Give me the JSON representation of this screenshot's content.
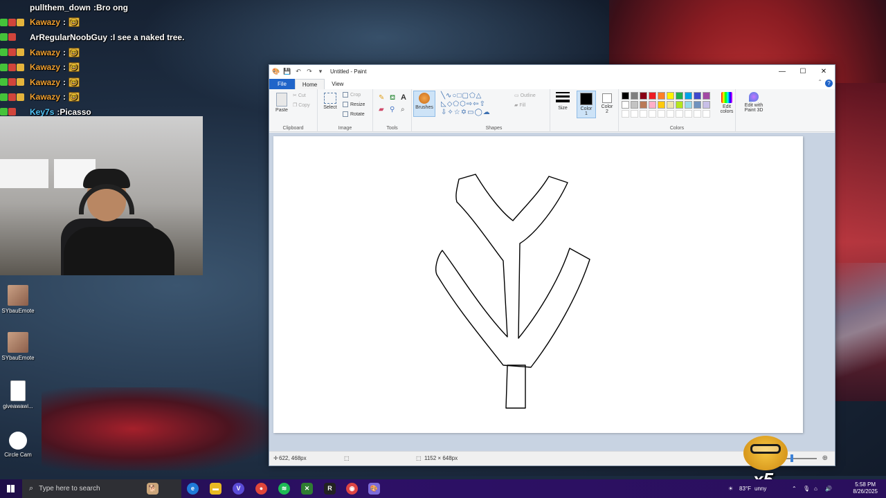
{
  "chat": {
    "messages": [
      {
        "user": "pullthem_down",
        "text": "Bro ong",
        "user_color": "#ffffff",
        "badges": [],
        "emote": false
      },
      {
        "user": "Kawazy",
        "text": "",
        "user_color": "#f0a030",
        "badges": [
          "green",
          "red",
          "gold"
        ],
        "emote": true
      },
      {
        "user": "ArRegularNoobGuy",
        "text": "I see a naked tree.",
        "user_color": "#ffffff",
        "badges": [
          "green",
          "red"
        ],
        "emote": false
      },
      {
        "user": "Kawazy",
        "text": "",
        "user_color": "#f0a030",
        "badges": [
          "green",
          "red",
          "gold"
        ],
        "emote": true
      },
      {
        "user": "Kawazy",
        "text": "",
        "user_color": "#f0a030",
        "badges": [
          "green",
          "red",
          "gold"
        ],
        "emote": true
      },
      {
        "user": "Kawazy",
        "text": "",
        "user_color": "#f0a030",
        "badges": [
          "green",
          "red",
          "gold"
        ],
        "emote": true
      },
      {
        "user": "Kawazy",
        "text": "",
        "user_color": "#f0a030",
        "badges": [
          "green",
          "red",
          "gold"
        ],
        "emote": true
      },
      {
        "user": "Key7s",
        "text": "Picasso",
        "user_color": "#4fc3f7",
        "badges": [
          "green",
          "red"
        ],
        "emote": false
      }
    ]
  },
  "desktop_icons": [
    {
      "label": "SYbauEmote",
      "icon": "photo-thumbnail"
    },
    {
      "label": "SYbauEmote",
      "icon": "photo-thumbnail"
    },
    {
      "label": "giveawawi...",
      "icon": "text-document-icon"
    },
    {
      "label": "Circle Cam",
      "icon": "white-circle-icon"
    }
  ],
  "paint": {
    "title": "Untitled - Paint",
    "window_controls": {
      "minimize": "—",
      "maximize": "☐",
      "close": "✕"
    },
    "tabs": {
      "file": "File",
      "home": "Home",
      "view": "View"
    },
    "ribbon": {
      "clipboard": {
        "label": "Clipboard",
        "paste": "Paste",
        "cut": "Cut",
        "copy": "Copy"
      },
      "image": {
        "label": "Image",
        "select": "Select",
        "crop": "Crop",
        "resize": "Resize",
        "rotate": "Rotate"
      },
      "tools": {
        "label": "Tools"
      },
      "brushes": {
        "label": "Brushes"
      },
      "shapes": {
        "label": "Shapes",
        "outline": "Outline",
        "fill": "Fill"
      },
      "size": {
        "label": "Size"
      },
      "color1": {
        "label": "Color",
        "sub": "1"
      },
      "color2": {
        "label": "Color",
        "sub": "2"
      },
      "colors": {
        "label": "Colors",
        "edit": "Edit colors"
      },
      "paint3d": {
        "label": "Edit with Paint 3D"
      }
    },
    "palette_row1": [
      "#000000",
      "#7f7f7f",
      "#880015",
      "#ed1c24",
      "#ff7f27",
      "#fff200",
      "#22b14c",
      "#00a2e8",
      "#3f48cc",
      "#a349a4"
    ],
    "palette_row2": [
      "#ffffff",
      "#c3c3c3",
      "#b97a57",
      "#ffaec9",
      "#ffc90e",
      "#efe4b0",
      "#b5e61d",
      "#99d9ea",
      "#7092be",
      "#c8bfe7"
    ],
    "color1": "#000000",
    "color2": "#ffffff",
    "status": {
      "cursor_pos": "622, 468px",
      "canvas_size": "1152 × 648px"
    }
  },
  "overlay": {
    "emote_count": "x5"
  },
  "taskbar": {
    "search_placeholder": "Type here to search",
    "weather": "83°F",
    "weather_suffix": "unny",
    "time": "5:58 PM",
    "date": "8/26/2025"
  }
}
